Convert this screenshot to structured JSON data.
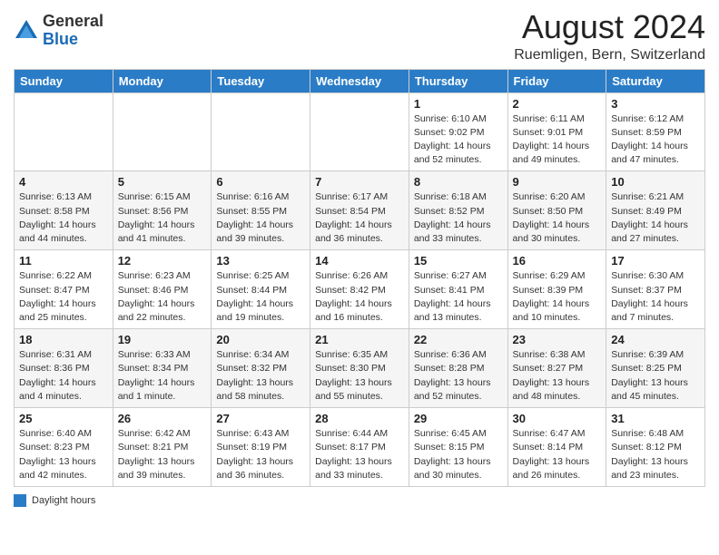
{
  "logo": {
    "general": "General",
    "blue": "Blue"
  },
  "title": "August 2024",
  "location": "Ruemligen, Bern, Switzerland",
  "days_of_week": [
    "Sunday",
    "Monday",
    "Tuesday",
    "Wednesday",
    "Thursday",
    "Friday",
    "Saturday"
  ],
  "legend_label": "Daylight hours",
  "weeks": [
    [
      {
        "day": "",
        "info": ""
      },
      {
        "day": "",
        "info": ""
      },
      {
        "day": "",
        "info": ""
      },
      {
        "day": "",
        "info": ""
      },
      {
        "day": "1",
        "info": "Sunrise: 6:10 AM\nSunset: 9:02 PM\nDaylight: 14 hours\nand 52 minutes."
      },
      {
        "day": "2",
        "info": "Sunrise: 6:11 AM\nSunset: 9:01 PM\nDaylight: 14 hours\nand 49 minutes."
      },
      {
        "day": "3",
        "info": "Sunrise: 6:12 AM\nSunset: 8:59 PM\nDaylight: 14 hours\nand 47 minutes."
      }
    ],
    [
      {
        "day": "4",
        "info": "Sunrise: 6:13 AM\nSunset: 8:58 PM\nDaylight: 14 hours\nand 44 minutes."
      },
      {
        "day": "5",
        "info": "Sunrise: 6:15 AM\nSunset: 8:56 PM\nDaylight: 14 hours\nand 41 minutes."
      },
      {
        "day": "6",
        "info": "Sunrise: 6:16 AM\nSunset: 8:55 PM\nDaylight: 14 hours\nand 39 minutes."
      },
      {
        "day": "7",
        "info": "Sunrise: 6:17 AM\nSunset: 8:54 PM\nDaylight: 14 hours\nand 36 minutes."
      },
      {
        "day": "8",
        "info": "Sunrise: 6:18 AM\nSunset: 8:52 PM\nDaylight: 14 hours\nand 33 minutes."
      },
      {
        "day": "9",
        "info": "Sunrise: 6:20 AM\nSunset: 8:50 PM\nDaylight: 14 hours\nand 30 minutes."
      },
      {
        "day": "10",
        "info": "Sunrise: 6:21 AM\nSunset: 8:49 PM\nDaylight: 14 hours\nand 27 minutes."
      }
    ],
    [
      {
        "day": "11",
        "info": "Sunrise: 6:22 AM\nSunset: 8:47 PM\nDaylight: 14 hours\nand 25 minutes."
      },
      {
        "day": "12",
        "info": "Sunrise: 6:23 AM\nSunset: 8:46 PM\nDaylight: 14 hours\nand 22 minutes."
      },
      {
        "day": "13",
        "info": "Sunrise: 6:25 AM\nSunset: 8:44 PM\nDaylight: 14 hours\nand 19 minutes."
      },
      {
        "day": "14",
        "info": "Sunrise: 6:26 AM\nSunset: 8:42 PM\nDaylight: 14 hours\nand 16 minutes."
      },
      {
        "day": "15",
        "info": "Sunrise: 6:27 AM\nSunset: 8:41 PM\nDaylight: 14 hours\nand 13 minutes."
      },
      {
        "day": "16",
        "info": "Sunrise: 6:29 AM\nSunset: 8:39 PM\nDaylight: 14 hours\nand 10 minutes."
      },
      {
        "day": "17",
        "info": "Sunrise: 6:30 AM\nSunset: 8:37 PM\nDaylight: 14 hours\nand 7 minutes."
      }
    ],
    [
      {
        "day": "18",
        "info": "Sunrise: 6:31 AM\nSunset: 8:36 PM\nDaylight: 14 hours\nand 4 minutes."
      },
      {
        "day": "19",
        "info": "Sunrise: 6:33 AM\nSunset: 8:34 PM\nDaylight: 14 hours\nand 1 minute."
      },
      {
        "day": "20",
        "info": "Sunrise: 6:34 AM\nSunset: 8:32 PM\nDaylight: 13 hours\nand 58 minutes."
      },
      {
        "day": "21",
        "info": "Sunrise: 6:35 AM\nSunset: 8:30 PM\nDaylight: 13 hours\nand 55 minutes."
      },
      {
        "day": "22",
        "info": "Sunrise: 6:36 AM\nSunset: 8:28 PM\nDaylight: 13 hours\nand 52 minutes."
      },
      {
        "day": "23",
        "info": "Sunrise: 6:38 AM\nSunset: 8:27 PM\nDaylight: 13 hours\nand 48 minutes."
      },
      {
        "day": "24",
        "info": "Sunrise: 6:39 AM\nSunset: 8:25 PM\nDaylight: 13 hours\nand 45 minutes."
      }
    ],
    [
      {
        "day": "25",
        "info": "Sunrise: 6:40 AM\nSunset: 8:23 PM\nDaylight: 13 hours\nand 42 minutes."
      },
      {
        "day": "26",
        "info": "Sunrise: 6:42 AM\nSunset: 8:21 PM\nDaylight: 13 hours\nand 39 minutes."
      },
      {
        "day": "27",
        "info": "Sunrise: 6:43 AM\nSunset: 8:19 PM\nDaylight: 13 hours\nand 36 minutes."
      },
      {
        "day": "28",
        "info": "Sunrise: 6:44 AM\nSunset: 8:17 PM\nDaylight: 13 hours\nand 33 minutes."
      },
      {
        "day": "29",
        "info": "Sunrise: 6:45 AM\nSunset: 8:15 PM\nDaylight: 13 hours\nand 30 minutes."
      },
      {
        "day": "30",
        "info": "Sunrise: 6:47 AM\nSunset: 8:14 PM\nDaylight: 13 hours\nand 26 minutes."
      },
      {
        "day": "31",
        "info": "Sunrise: 6:48 AM\nSunset: 8:12 PM\nDaylight: 13 hours\nand 23 minutes."
      }
    ]
  ]
}
